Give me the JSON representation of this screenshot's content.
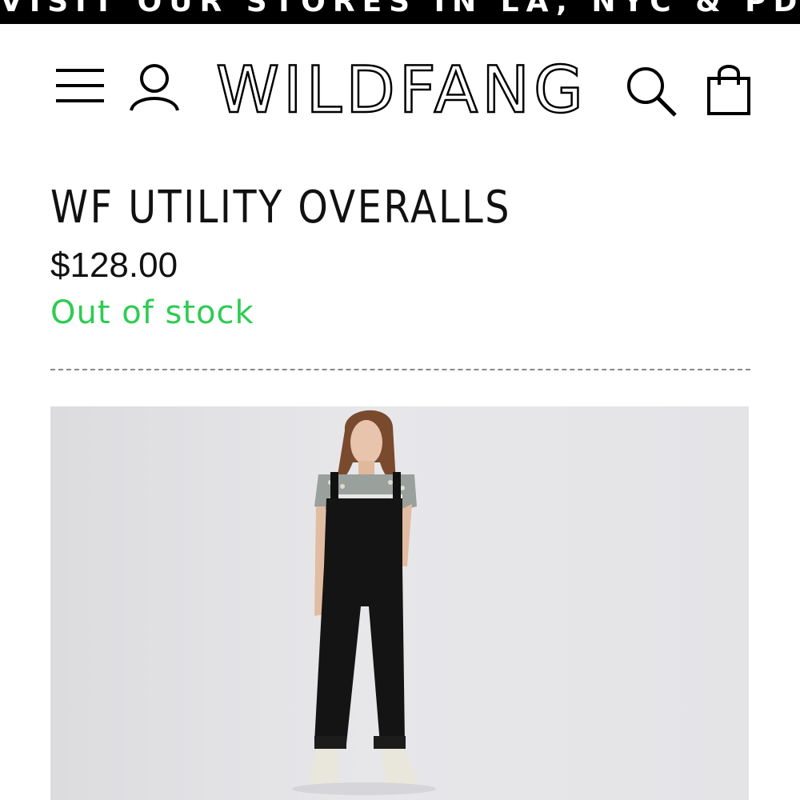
{
  "promo": {
    "text": "VISIT OUR STORES IN LA, NYC & PDX."
  },
  "header": {
    "logo": "WILDFANG",
    "icons": [
      "menu-icon",
      "account-icon",
      "search-icon",
      "cart-icon"
    ]
  },
  "product": {
    "title": "WF UTILITY OVERALLS",
    "price": "$128.00",
    "stock_status": "Out of stock",
    "stock_color": "#2ecc52"
  }
}
